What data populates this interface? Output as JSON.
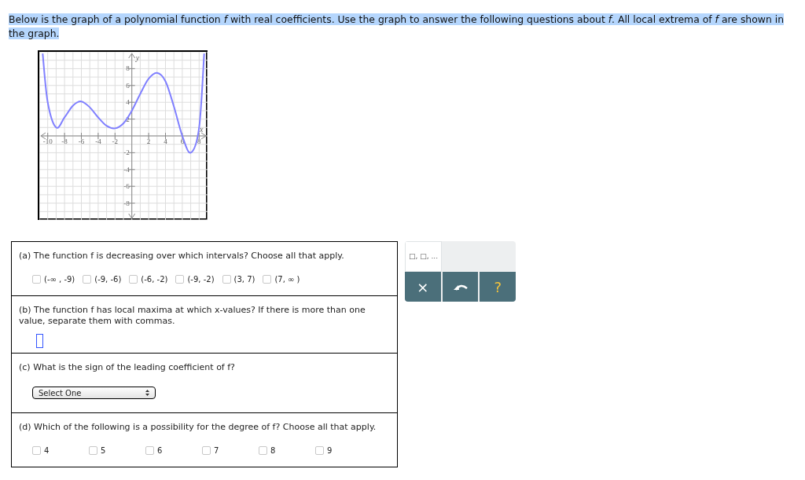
{
  "intro": "Below is the graph of a polynomial function *f* with real coefficients. Use the graph to answer the following questions about *f*. All local extrema of *f* are shown in the graph.",
  "graph": {
    "chart_data": {
      "type": "line",
      "grid": true,
      "xlabel": "x",
      "ylabel": "y",
      "xlim": [
        -11,
        9
      ],
      "ylim": [
        -10,
        10
      ],
      "xticks": [
        -10,
        -8,
        -6,
        -4,
        -2,
        2,
        4,
        6,
        8
      ],
      "yticks": [
        -8,
        -6,
        -4,
        -2,
        2,
        4,
        6,
        8
      ],
      "x": [
        -10.6,
        -10,
        -9,
        -8,
        -7,
        -6,
        -5,
        -4,
        -3,
        -2,
        -1,
        0,
        1,
        2,
        3,
        4,
        5,
        6,
        7,
        8,
        8.6
      ],
      "series": [
        {
          "color": "#8080ff",
          "values": [
            9.8,
            4,
            1,
            2.2,
            3.6,
            4.1,
            3.4,
            2.2,
            1.2,
            0.9,
            1.5,
            3,
            5,
            6.8,
            7.5,
            6.5,
            3.5,
            0,
            -2,
            1,
            9.8
          ]
        }
      ]
    }
  },
  "questions": [
    {
      "kind": "checkboxes",
      "prompt": "(a) The function f is decreasing over which intervals? Choose all that apply.",
      "options": [
        {
          "label": "(-∞ , -9)",
          "checked": false
        },
        {
          "label": "(-9, -6)",
          "checked": false
        },
        {
          "label": "(-6, -2)",
          "checked": false
        },
        {
          "label": "(-9, -2)",
          "checked": false
        },
        {
          "label": "(3, 7)",
          "checked": false
        },
        {
          "label": "(7, ∞ )",
          "checked": false
        }
      ]
    },
    {
      "kind": "answer",
      "prompt": "(b) The function f has local maxima at which x-values? If there is more than one value, separate them with commas."
    },
    {
      "kind": "select",
      "prompt": "(c) What is the sign of the leading coefficient of f?",
      "value": "Select One"
    },
    {
      "kind": "checkboxes",
      "prompt": "(d) Which of the following is a possibility for the degree of f? Choose all that apply.",
      "options": [
        {
          "label": "4",
          "checked": false
        },
        {
          "label": "5",
          "checked": false
        },
        {
          "label": "6",
          "checked": false
        },
        {
          "label": "7",
          "checked": false
        },
        {
          "label": "8",
          "checked": false
        },
        {
          "label": "9",
          "checked": false
        }
      ]
    }
  ],
  "tools": {
    "template": "□, □, ...",
    "clear": "×",
    "help": "?"
  }
}
